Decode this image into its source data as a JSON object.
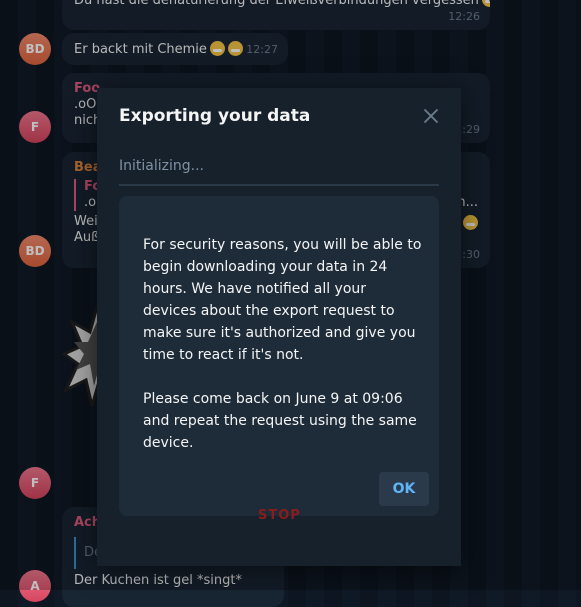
{
  "chat": {
    "messages": [
      {
        "text": "Du hast die denaturierung der Eiweißverbindungen vergessen",
        "time": "12:26"
      },
      {
        "avatar": "BD",
        "text": "Er backt mit Chemie",
        "time": "12:27"
      },
      {
        "avatar": "F",
        "sender": "Foo",
        "lines": [
          ".oOr",
          "nich"
        ],
        "time": "12:29"
      },
      {
        "avatar": "BD",
        "sender": "Bea",
        "quote_sender": "Fo",
        "quote_text": ".ou",
        "quote_suffix": "n...",
        "lines": [
          "Wei",
          "Auß"
        ],
        "time": "12:30"
      },
      {
        "avatar": "F"
      },
      {
        "avatar": "A",
        "sender": "Ach",
        "quote_text": "De",
        "text": "Der Kuchen ist gel *singt*"
      }
    ],
    "sticker_text": "STOP"
  },
  "modal": {
    "title": "Exporting your data",
    "progress_label": "Initializing...",
    "progress": 0,
    "paragraph1": "For security reasons, you will be able to begin downloading your data in 24 hours. We have notified all your devices about the export request to make sure it's authorized and give you time to react if it's not.",
    "paragraph2": "Please come back on June 9 at 09:06 and repeat the request using the same device.",
    "ok_label": "OK"
  },
  "colors": {
    "accent": "#5eb5f7",
    "background": "#0e1621",
    "modal": "#17212b",
    "sender_pink": "#e35d80"
  }
}
